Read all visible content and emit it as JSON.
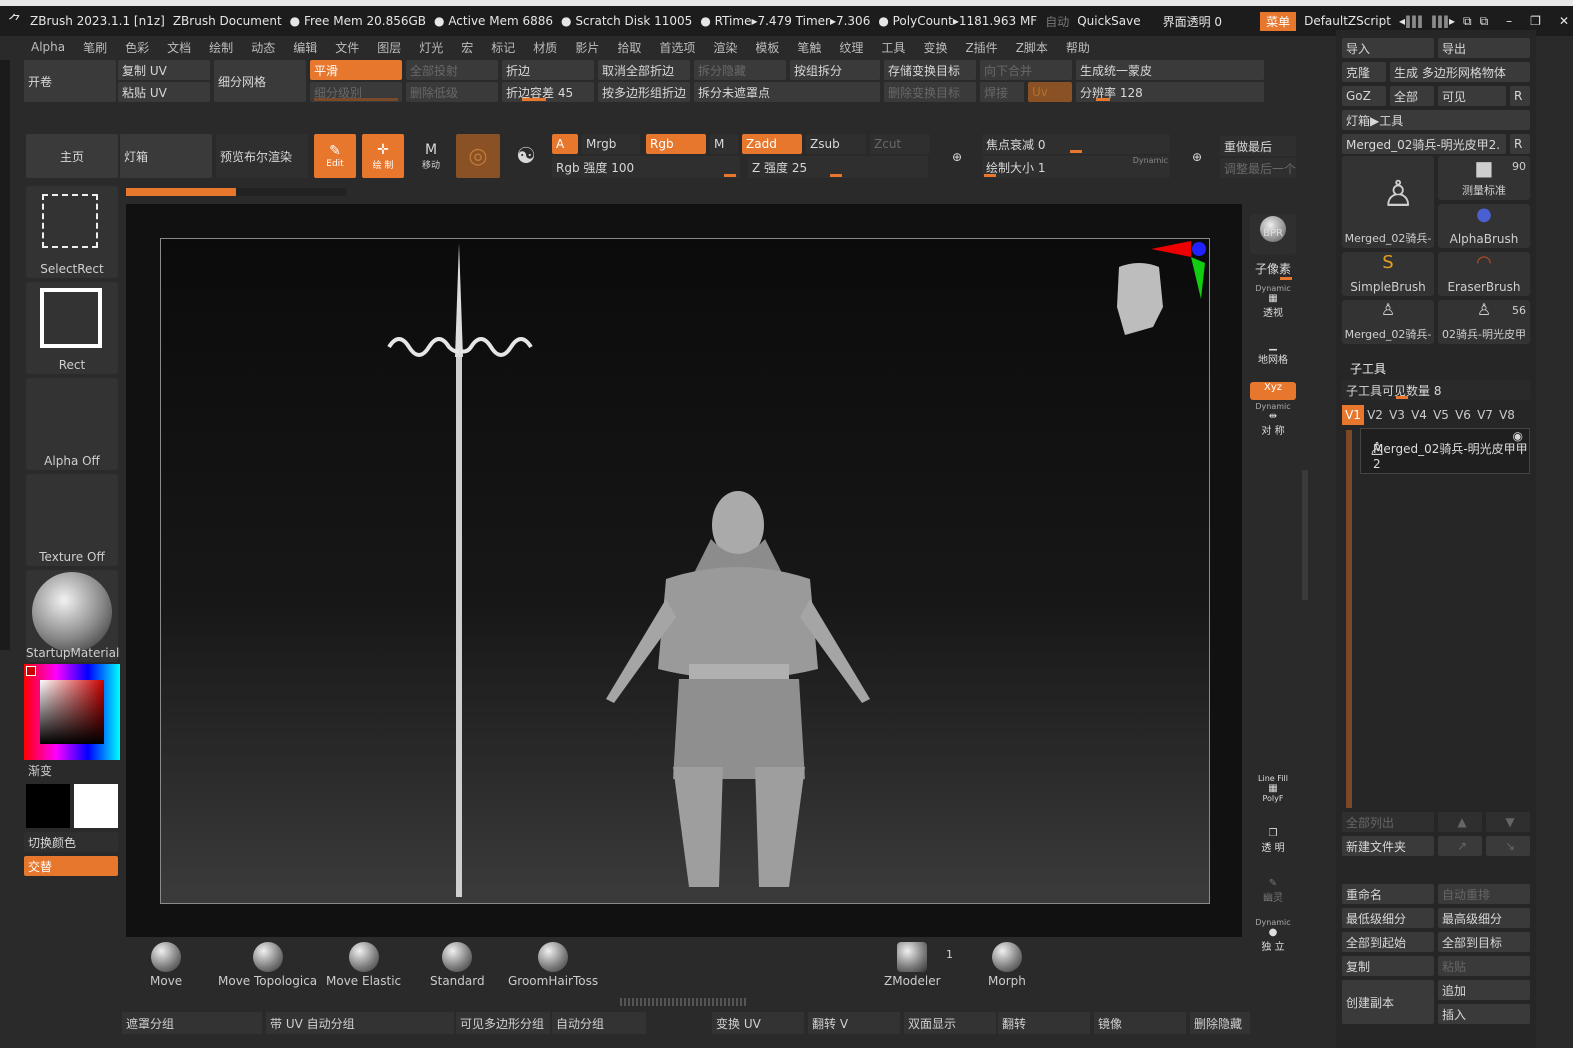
{
  "titlebar": {
    "app": "ZBrush 2023.1.1 [n1z]",
    "doc": "ZBrush Document",
    "free_mem": "Free Mem 20.856GB",
    "active_mem": "Active Mem 6886",
    "scratch": "Scratch Disk 11005",
    "rtime": "RTime▸7.479 Timer▸7.306",
    "polycount": "PolyCount▸1181.963 MF",
    "auto": "自动",
    "quicksave": "QuickSave",
    "transparency": "界面透明 0",
    "menu": "菜单",
    "script": "DefaultZScript"
  },
  "menu": [
    "Alpha",
    "笔刷",
    "色彩",
    "文档",
    "绘制",
    "动态",
    "编辑",
    "文件",
    "图层",
    "灯光",
    "宏",
    "标记",
    "材质",
    "影片",
    "拾取",
    "首选项",
    "渲染",
    "模板",
    "笔触",
    "纹理",
    "工具",
    "变换",
    "Z插件",
    "Z脚本",
    "帮助"
  ],
  "topbar": {
    "open_roll": "开卷",
    "copy_uv": "复制 UV",
    "paste_uv": "粘贴 UV",
    "subdiv_mesh": "细分网格",
    "smooth": "平滑",
    "subdiv_level": "细分级别",
    "project_all": "全部投射",
    "del_lower": "删除低级",
    "crease": "折边",
    "crease_tol": "折边容差 45",
    "uncrease_all": "取消全部折边",
    "crease_pg": "按多边形组折边",
    "split_hidden": "拆分隐藏",
    "split_unmasked": "拆分未遮罩点",
    "group_split": "按组拆分",
    "store_morph": "存储变换目标",
    "del_morph": "删除变换目标",
    "merge_down": "向下合并",
    "weld": "焊接",
    "uv": "Uv",
    "unified_skin": "生成统一蒙皮",
    "resolution": "分辨率 128"
  },
  "toolbar2": {
    "home": "主页",
    "lightbox": "灯箱",
    "bool_preview": "预览布尔渲染",
    "edit": "Edit",
    "draw": "绘 制",
    "move": "移动",
    "a": "A",
    "mrgb": "Mrgb",
    "rgb": "Rgb",
    "m": "M",
    "zadd": "Zadd",
    "zsub": "Zsub",
    "zcut": "Zcut",
    "rgb_intensity": "Rgb 强度 100",
    "z_intensity": "Z 强度 25",
    "focal": "焦点衰减 0",
    "draw_size": "绘制大小 1",
    "dynamic": "Dynamic",
    "redo_last": "重做最后",
    "adjust_last": "调整最后一个"
  },
  "left": {
    "select_rect": "SelectRect",
    "rect": "Rect",
    "alpha_off": "Alpha Off",
    "texture_off": "Texture Off",
    "material": "StartupMaterial",
    "gradient": "渐变",
    "switch_color": "切换颜色",
    "alternate": "交替"
  },
  "right_shelf": {
    "bpr": "BPR",
    "subpixel": "子像素",
    "dynamic": "Dynamic",
    "persp": "透视",
    "floor": "地网格",
    "xyz": "Xyz",
    "sym": "对 称",
    "line_fill": "Line Fill",
    "polyf": "PolyF",
    "transp": "透 明",
    "ghost": "幽灵",
    "solo": "独 立"
  },
  "brushes": [
    "Move",
    "Move Topologica",
    "Move Elastic",
    "Standard",
    "GroomHairToss",
    "ZModeler",
    "Morph"
  ],
  "zmodeler_count": "1",
  "bottombar": [
    "遮罩分组",
    "带 UV 自动分组",
    "可见多边形分组",
    "自动分组",
    "变换 UV",
    "翻转 V",
    "双面显示",
    "翻转",
    "镜像",
    "删除隐藏"
  ],
  "right": {
    "import": "导入",
    "export": "导出",
    "clone": "克隆",
    "make_polymesh": "生成 多边形网格物体",
    "goz": "GoZ",
    "all": "全部",
    "visible": "可见",
    "r": "R",
    "lightbox_tools": "灯箱▶工具",
    "current_tool": "Merged_02骑兵-明光皮甲2.",
    "tools": [
      {
        "label": "Merged_02骑兵-"
      },
      {
        "label": "测量标准",
        "count": "90"
      },
      {
        "label": "AlphaBrush"
      },
      {
        "label": "SimpleBrush"
      },
      {
        "label": "EraserBrush"
      },
      {
        "label": "Merged_02骑兵-"
      },
      {
        "label": "02骑兵-明光皮甲",
        "count": "56"
      }
    ],
    "subtool": "子工具",
    "visible_count": "子工具可见数量 8",
    "vtabs": [
      "V1",
      "V2",
      "V3",
      "V4",
      "V5",
      "V6",
      "V7",
      "V8"
    ],
    "subtool_item": "Merged_02骑兵-明光皮甲甲2",
    "list_all": "全部列出",
    "new_folder": "新建文件夹",
    "rename": "重命名",
    "auto_reorder": "自动重排",
    "lowest_sub": "最低级细分",
    "highest_sub": "最高级细分",
    "all_to_start": "全部到起始",
    "all_to_target": "全部到目标",
    "copy": "复制",
    "paste": "粘贴",
    "duplicate": "创建副本",
    "append": "追加",
    "insert": "插入"
  }
}
